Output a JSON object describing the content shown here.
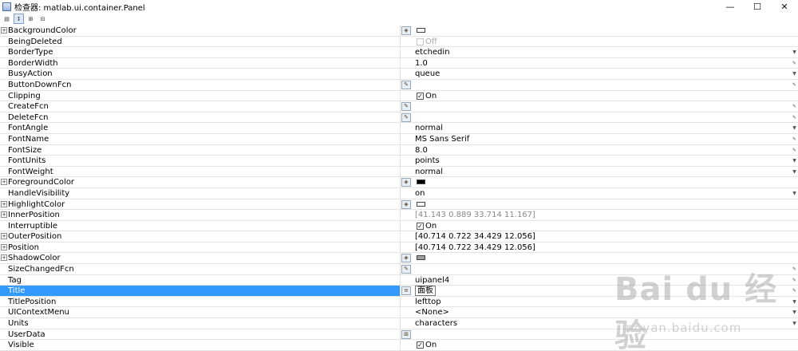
{
  "window": {
    "title": "检查器:  matlab.ui.container.Panel",
    "minimize": "—",
    "maximize": "☐",
    "close": "✕"
  },
  "toolbar": {
    "buttons": [
      {
        "icon": "categorized-icon",
        "glyph": "▤"
      },
      {
        "icon": "sort-az-icon",
        "glyph": "↕"
      },
      {
        "icon": "expand-all-icon",
        "glyph": "⊞"
      },
      {
        "icon": "collapse-all-icon",
        "glyph": "⊟"
      }
    ]
  },
  "properties": [
    {
      "name": "BackgroundColor",
      "expandable": true,
      "editor": "color",
      "value_type": "swatch",
      "swatch_color": "#ffffff"
    },
    {
      "name": "BeingDeleted",
      "value_type": "checkbox",
      "checked": false,
      "disabled": true,
      "value": "Off"
    },
    {
      "name": "BorderType",
      "value": "etchedin",
      "right": "dropdown"
    },
    {
      "name": "BorderWidth",
      "value": "1.0",
      "right": "edit"
    },
    {
      "name": "BusyAction",
      "value": "queue",
      "right": "dropdown"
    },
    {
      "name": "ButtonDownFcn",
      "editor": "callback",
      "value": "",
      "right": "edit"
    },
    {
      "name": "Clipping",
      "value_type": "checkbox",
      "checked": true,
      "value": "On"
    },
    {
      "name": "CreateFcn",
      "editor": "callback",
      "value": "",
      "right": "edit"
    },
    {
      "name": "DeleteFcn",
      "editor": "callback",
      "value": "",
      "right": "edit"
    },
    {
      "name": "FontAngle",
      "value": "normal",
      "right": "dropdown"
    },
    {
      "name": "FontName",
      "value": "MS Sans Serif",
      "right": "edit"
    },
    {
      "name": "FontSize",
      "value": "8.0",
      "right": "edit"
    },
    {
      "name": "FontUnits",
      "value": "points",
      "right": "dropdown"
    },
    {
      "name": "FontWeight",
      "value": "normal",
      "right": "dropdown"
    },
    {
      "name": "ForegroundColor",
      "expandable": true,
      "editor": "color",
      "value_type": "swatch",
      "swatch_color": "#000000"
    },
    {
      "name": "HandleVisibility",
      "value": "on",
      "right": "dropdown"
    },
    {
      "name": "HighlightColor",
      "expandable": true,
      "editor": "color",
      "value_type": "swatch",
      "swatch_color": "#ffffff"
    },
    {
      "name": "InnerPosition",
      "expandable": true,
      "value": "[41.143 0.889 33.714 11.167]",
      "gray": true
    },
    {
      "name": "Interruptible",
      "value_type": "checkbox",
      "checked": true,
      "value": "On"
    },
    {
      "name": "OuterPosition",
      "expandable": true,
      "value": "[40.714 0.722 34.429 12.056]"
    },
    {
      "name": "Position",
      "expandable": true,
      "value": "[40.714 0.722 34.429 12.056]"
    },
    {
      "name": "ShadowColor",
      "expandable": true,
      "editor": "color",
      "value_type": "swatch",
      "swatch_color": "#a0a0a0"
    },
    {
      "name": "SizeChangedFcn",
      "editor": "callback",
      "value": "",
      "right": "edit"
    },
    {
      "name": "Tag",
      "value": "uipanel4",
      "right": "edit"
    },
    {
      "name": "Title",
      "editor": "text",
      "value": "面板",
      "selected": true,
      "right": "edit"
    },
    {
      "name": "TitlePosition",
      "value": "lefttop",
      "right": "dropdown"
    },
    {
      "name": "UIContextMenu",
      "value": "<None>",
      "right": "dropdown"
    },
    {
      "name": "Units",
      "value": "characters",
      "right": "dropdown"
    },
    {
      "name": "UserData",
      "editor": "table",
      "value": ""
    },
    {
      "name": "Visible",
      "value_type": "checkbox",
      "checked": true,
      "value": "On"
    }
  ],
  "watermark": {
    "logo": "Bai du 经验",
    "url": "jingyan.baidu.com"
  }
}
